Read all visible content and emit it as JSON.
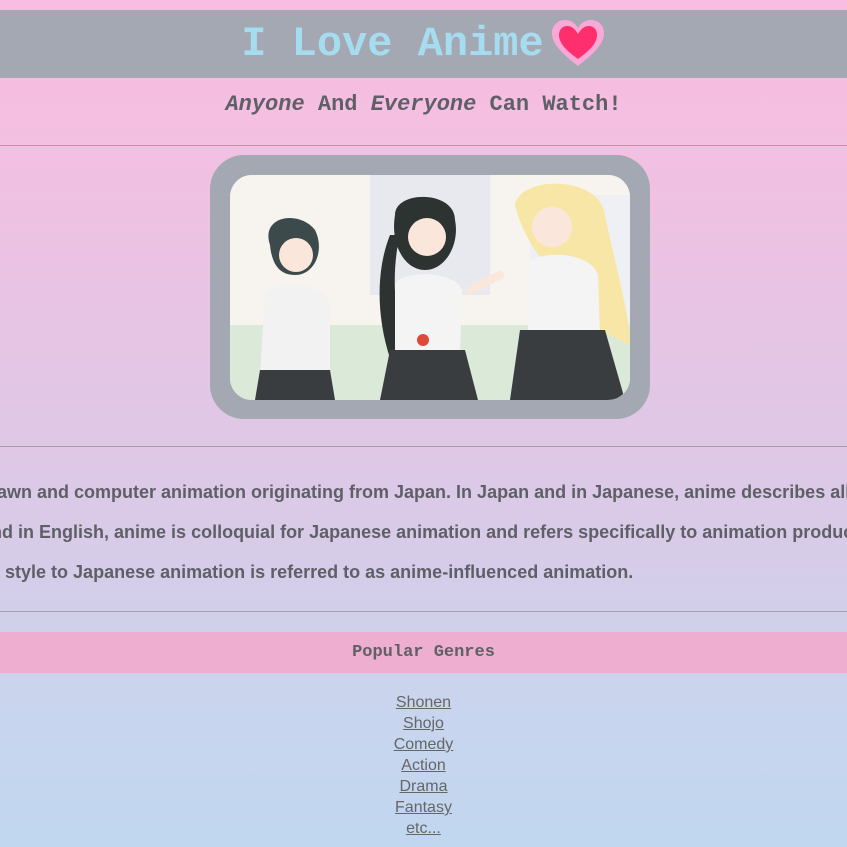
{
  "header": {
    "title": "I Love Anime",
    "icon": "heart-icon",
    "title_color": "#a6dcef",
    "bar_color": "#a3a8b2"
  },
  "subtitle": {
    "part1": "Anyone",
    "part2": "And",
    "part3": "Everyone",
    "part4": "Can Watch!"
  },
  "description": {
    "lines": [
      "Anime is hand-drawn and computer animation originating from Japan. In Japan and in Japanese, anime describes all animated works.",
      "Outside of Japan and in English, anime is colloquial for Japanese animation and refers specifically to animation produced in Japan.",
      "Animation similar in style to Japanese animation is referred to as anime-influenced animation."
    ]
  },
  "genres": {
    "heading": "Popular Genres",
    "items": [
      "Shonen",
      "Shojo",
      "Comedy",
      "Action",
      "Drama",
      "Fantasy",
      "etc..."
    ]
  },
  "colors": {
    "accent_pink": "#edaed0",
    "text": "#5f5f68"
  }
}
